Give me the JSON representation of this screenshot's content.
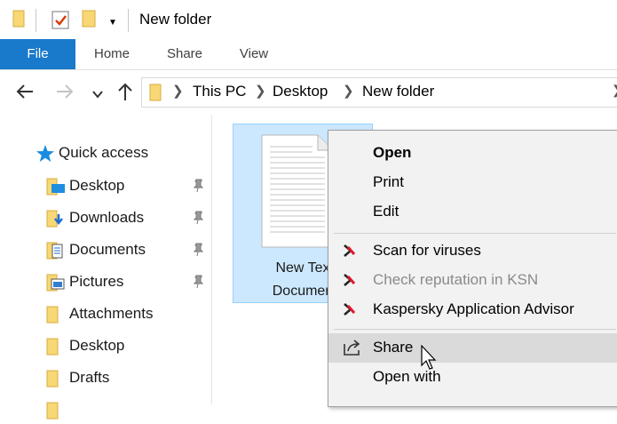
{
  "window": {
    "title": "New folder",
    "quick_toolbar": [
      "folder-icon",
      "properties-icon",
      "new-folder-icon",
      "customize-dropdown-icon"
    ]
  },
  "ribbon": {
    "tabs": [
      "File",
      "Home",
      "Share",
      "View"
    ],
    "active_tab": "File",
    "file_tab_color": "#1979ca"
  },
  "navigation": {
    "breadcrumb": [
      "This PC",
      "Desktop",
      "New folder"
    ]
  },
  "nav_pane": {
    "quick_access_label": "Quick access",
    "items": [
      {
        "label": "Desktop",
        "icon": "desktop-folder-icon",
        "pinned": true
      },
      {
        "label": "Downloads",
        "icon": "downloads-folder-icon",
        "pinned": true
      },
      {
        "label": "Documents",
        "icon": "documents-folder-icon",
        "pinned": true
      },
      {
        "label": "Pictures",
        "icon": "pictures-folder-icon",
        "pinned": true
      },
      {
        "label": "Attachments",
        "icon": "folder-icon",
        "pinned": false
      },
      {
        "label": "Desktop",
        "icon": "folder-icon",
        "pinned": false
      },
      {
        "label": "Drafts",
        "icon": "folder-icon",
        "pinned": false
      }
    ]
  },
  "content": {
    "selected_file": {
      "line1": "New Tex",
      "line2": "Documen",
      "icon": "text-document-icon",
      "selection_color": "#cce8ff"
    }
  },
  "context_menu": {
    "groups": [
      [
        {
          "label": "Open",
          "bold": true
        },
        {
          "label": "Print"
        },
        {
          "label": "Edit"
        }
      ],
      [
        {
          "label": "Scan for viruses",
          "icon": "kaspersky-icon"
        },
        {
          "label": "Check reputation in KSN",
          "icon": "kaspersky-icon",
          "disabled": true
        },
        {
          "label": "Kaspersky Application Advisor",
          "icon": "kaspersky-icon"
        }
      ],
      [
        {
          "label": "Share",
          "icon": "share-icon",
          "hovered": true
        },
        {
          "label": "Open with"
        }
      ]
    ]
  }
}
